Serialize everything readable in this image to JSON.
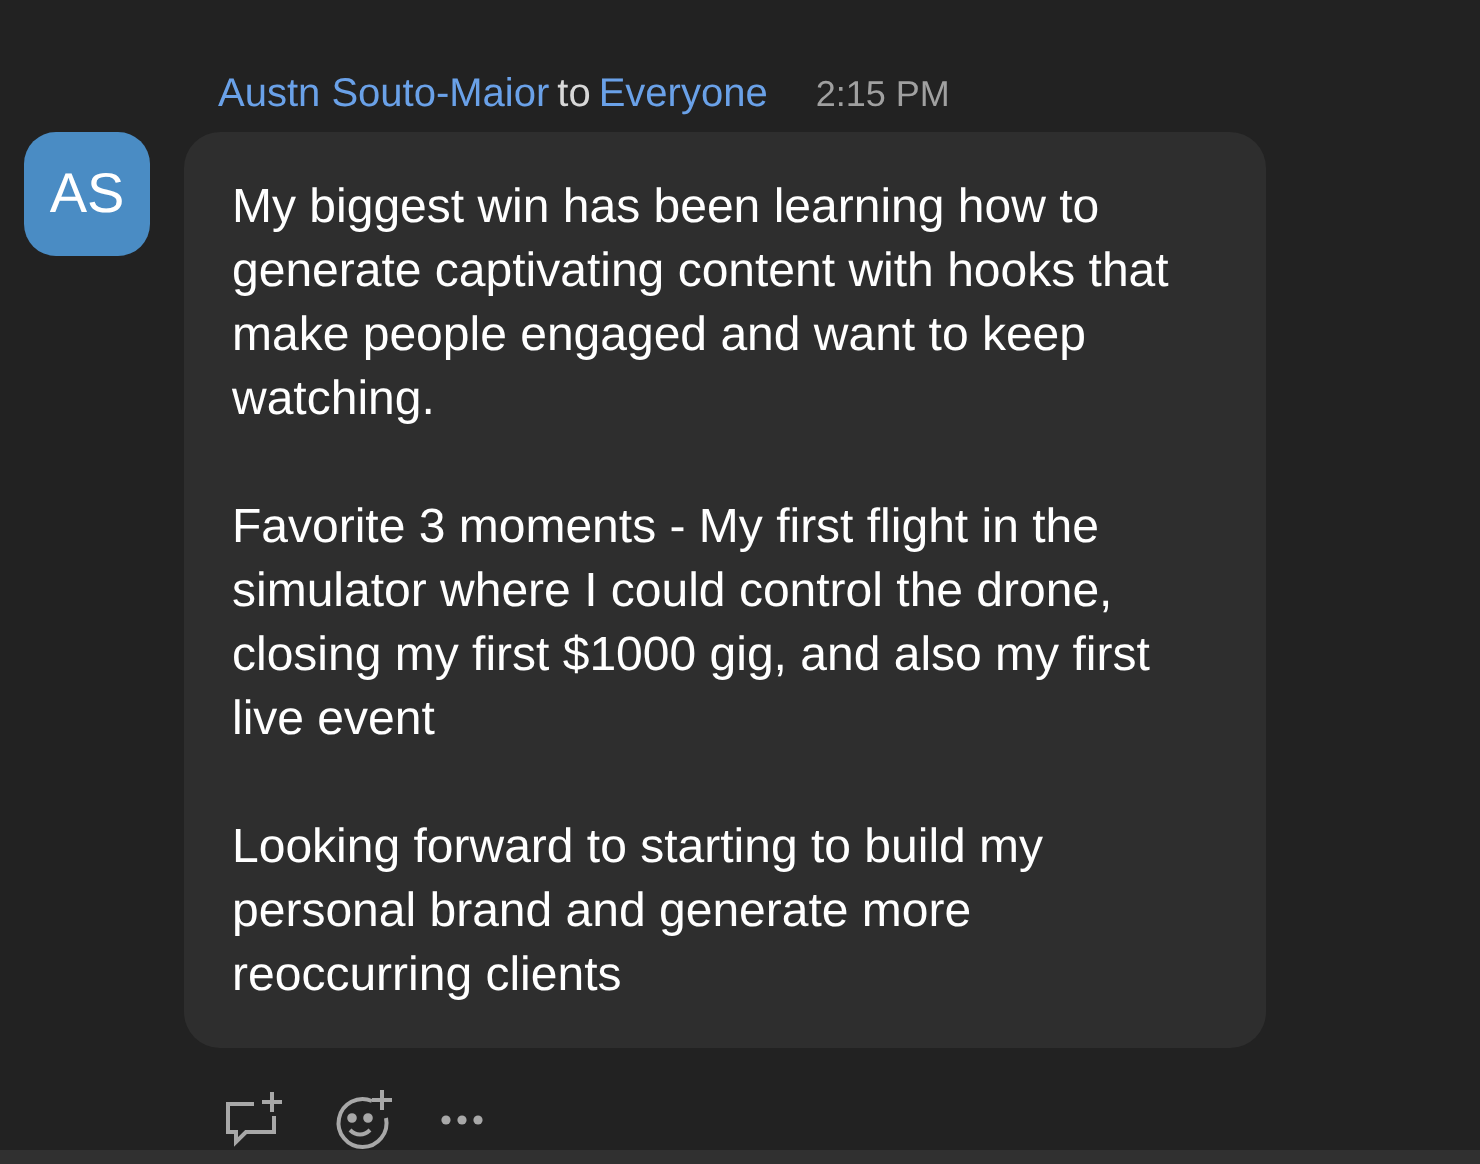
{
  "message": {
    "sender": "Austn Souto-Maior",
    "connector": "to",
    "recipient": "Everyone",
    "time": "2:15 PM",
    "avatar_initials": "AS",
    "paragraphs": [
      "My biggest win has been learning how to generate captivating content with hooks that make people engaged and want to keep watching.",
      "Favorite 3 moments - My first flight in the simulator where I could control the drone, closing my first $1000 gig, and also my first live event",
      "Looking forward to starting to build my personal brand and generate more reoccurring clients"
    ]
  }
}
